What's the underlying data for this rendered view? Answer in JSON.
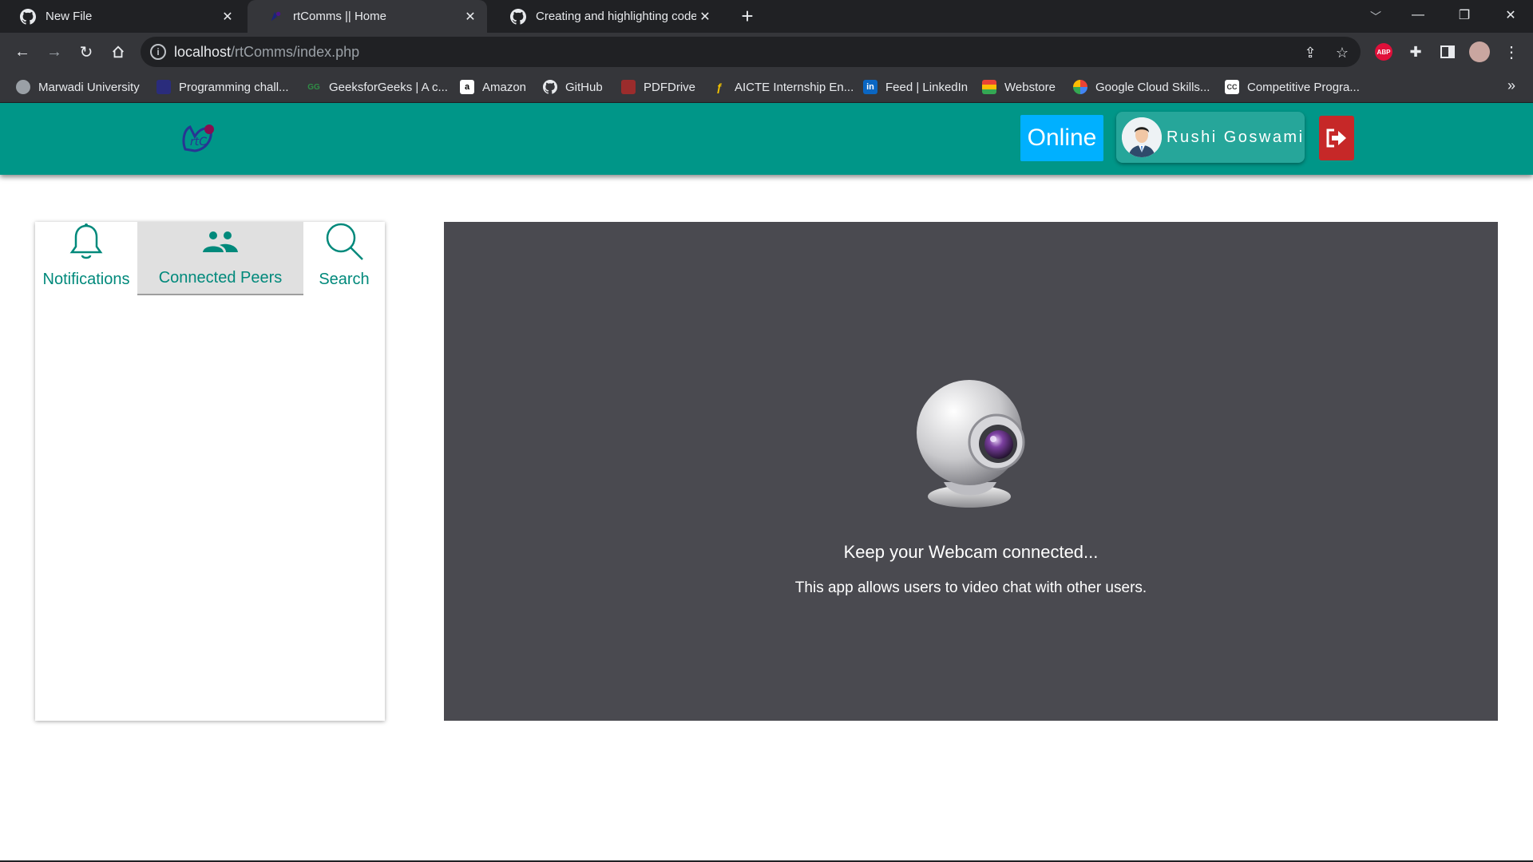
{
  "browser": {
    "tabs": [
      {
        "title": "New File",
        "icon": "github-icon",
        "active": false
      },
      {
        "title": "rtComms || Home",
        "icon": "rtcomms-favicon",
        "active": true
      },
      {
        "title": "Creating and highlighting code b",
        "icon": "github-icon",
        "active": false
      }
    ],
    "new_tab_label": "+",
    "url_host": "localhost",
    "url_path": "/rtComms/index.php",
    "extensions": [
      {
        "name": "adblock-plus",
        "label": "ABP",
        "color": "#e0103a"
      }
    ],
    "bookmarks": [
      {
        "label": "Marwadi University",
        "icon": "globe-icon",
        "color": "#9aa0a6"
      },
      {
        "label": "Programming chall...",
        "icon": "hackerrank-icon",
        "color": "#2a2c7c"
      },
      {
        "label": "GeeksforGeeks | A c...",
        "icon": "gfg-icon",
        "color": "#2f8d46"
      },
      {
        "label": "Amazon",
        "icon": "amazon-icon",
        "color": "#ffffff"
      },
      {
        "label": "GitHub",
        "icon": "github-icon",
        "color": "#ffffff"
      },
      {
        "label": "PDFDrive",
        "icon": "pdfdrive-icon",
        "color": "#9b2c2c"
      },
      {
        "label": "AICTE Internship En...",
        "icon": "aicte-icon",
        "color": "#f2c200"
      },
      {
        "label": "Feed | LinkedIn",
        "icon": "linkedin-icon",
        "color": "#0a66c2"
      },
      {
        "label": "Webstore",
        "icon": "webstore-icon",
        "color": "#e94235"
      },
      {
        "label": "Google Cloud Skills...",
        "icon": "google-cloud-icon",
        "color": "#4285f4"
      },
      {
        "label": "Competitive Progra...",
        "icon": "cc-icon",
        "color": "#ffffff"
      }
    ],
    "bookmarks_overflow": "»"
  },
  "app": {
    "status_label": "Online",
    "user_name": "Rushi Goswami",
    "colors": {
      "appbar": "#009688",
      "online": "#00b0ff",
      "logout": "#c62828",
      "accent": "#00897b",
      "video_bg": "#4a4a50"
    },
    "panel_tabs": [
      {
        "label": "Notifications",
        "icon": "bell-icon",
        "active": false
      },
      {
        "label": "Connected Peers",
        "icon": "people-icon",
        "active": true
      },
      {
        "label": "Search",
        "icon": "search-icon",
        "active": false
      }
    ],
    "video": {
      "headline": "Keep your Webcam connected...",
      "subtext": "This app allows users to video chat with other users."
    }
  }
}
